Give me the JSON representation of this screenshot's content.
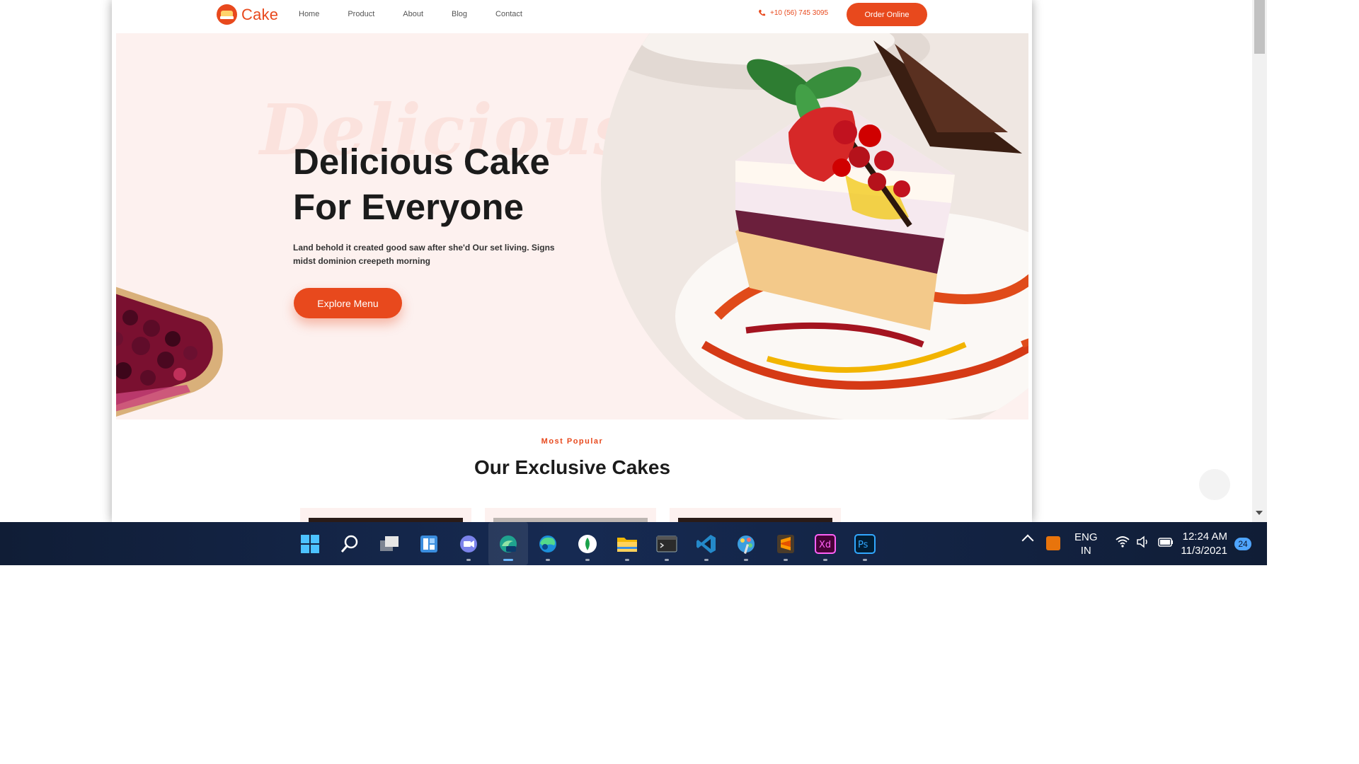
{
  "site": {
    "brand": "Cake",
    "nav": [
      "Home",
      "Product",
      "About",
      "Blog",
      "Contact"
    ],
    "phone": "+10 (56) 745 3095",
    "order_button": "Order Online",
    "hero": {
      "watermark": "Delicious",
      "title_line1": "Delicious Cake",
      "title_line2": "For Everyone",
      "description": "Land behold it created good saw after she'd Our set living. Signs midst dominion creepeth morning",
      "cta": "Explore Menu"
    },
    "section": {
      "tag": "Most Popular",
      "title": "Our Exclusive Cakes"
    }
  },
  "taskbar": {
    "apps": [
      "windows-start",
      "search",
      "task-view",
      "widgets",
      "teams-chat",
      "edge-beta",
      "edge",
      "whatsapp",
      "file-explorer",
      "terminal",
      "vscode",
      "paint",
      "sublime-text",
      "adobe-xd",
      "photoshop"
    ],
    "language_line1": "ENG",
    "language_line2": "IN",
    "time": "12:24 AM",
    "date": "11/3/2021",
    "notification_count": "24"
  },
  "colors": {
    "accent": "#e8491d",
    "hero_bg": "#fdf1ef",
    "taskbar": "#13234a"
  }
}
